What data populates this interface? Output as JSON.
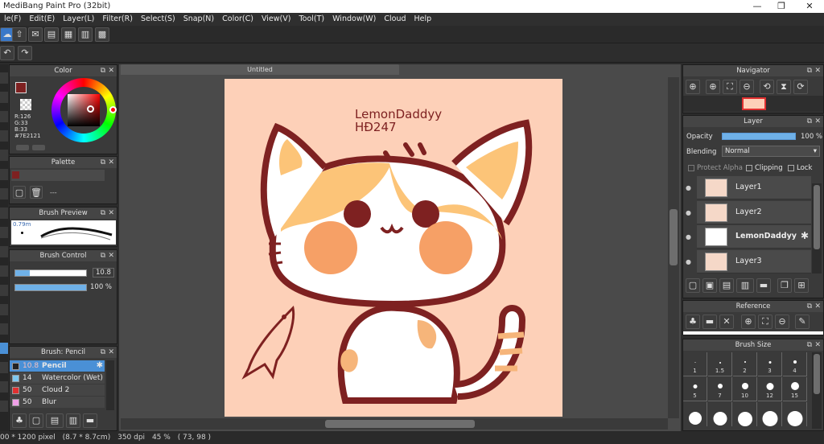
{
  "app": {
    "title": "MediBang Paint Pro (32bit)",
    "minimize": "—",
    "maximize": "❐",
    "close": "✕"
  },
  "menu": [
    "le(F)",
    "Edit(E)",
    "Layer(L)",
    "Filter(R)",
    "Select(S)",
    "Snap(N)",
    "Color(C)",
    "View(V)",
    "Tool(T)",
    "Window(W)",
    "Cloud",
    "Help"
  ],
  "document": {
    "tab": "Untitled"
  },
  "color_panel": {
    "title": "Color",
    "r": "R:126",
    "g": "G:33",
    "b": "B:33",
    "hex": "#7E2121",
    "primary": "#7e2121"
  },
  "palette_panel": {
    "title": "Palette",
    "placeholder": "---"
  },
  "brush_preview": {
    "title": "Brush Preview",
    "size": "0.79m"
  },
  "brush_control": {
    "title": "Brush Control",
    "size_value": "10.8",
    "opacity_value": "100 %",
    "size_fill": 0.2,
    "opacity_fill": 1.0
  },
  "brush_list": {
    "title": "Brush: Pencil",
    "items": [
      {
        "size": "10.8",
        "name": "Pencil",
        "color": "#222222"
      },
      {
        "size": "14",
        "name": "Watercolor (Wet)",
        "color": "#7ec8f0"
      },
      {
        "size": "50",
        "name": "Cloud 2",
        "color": "#e03030"
      },
      {
        "size": "50",
        "name": "Blur",
        "color": "#f0a0e8"
      }
    ]
  },
  "artwork": {
    "line1": "LemonDaddyy",
    "line2": "HĐ247"
  },
  "navigator": {
    "title": "Navigator"
  },
  "layer_panel": {
    "title": "Layer",
    "opacity_label": "Opacity",
    "opacity_value": "100 %",
    "opacity_fill": 1.0,
    "blending_label": "Blending",
    "blending_value": "Normal",
    "protect_alpha": "Protect Alpha",
    "clipping": "Clipping",
    "lock": "Lock",
    "layers": [
      {
        "name": "Layer1",
        "selected": false
      },
      {
        "name": "Layer2",
        "selected": false
      },
      {
        "name": "LemonDaddyy",
        "selected": true
      },
      {
        "name": "Layer3",
        "selected": false
      }
    ]
  },
  "reference_panel": {
    "title": "Reference"
  },
  "brush_size_panel": {
    "title": "Brush Size",
    "sizes": [
      "1",
      "1.5",
      "2",
      "3",
      "4",
      "5",
      "7",
      "10",
      "12",
      "15"
    ]
  },
  "status": {
    "size": "00 * 1200 pixel",
    "physical": "(8.7 * 8.7cm)",
    "dpi": "350 dpi",
    "zoom": "45 %",
    "coords": "( 73, 98 )"
  }
}
